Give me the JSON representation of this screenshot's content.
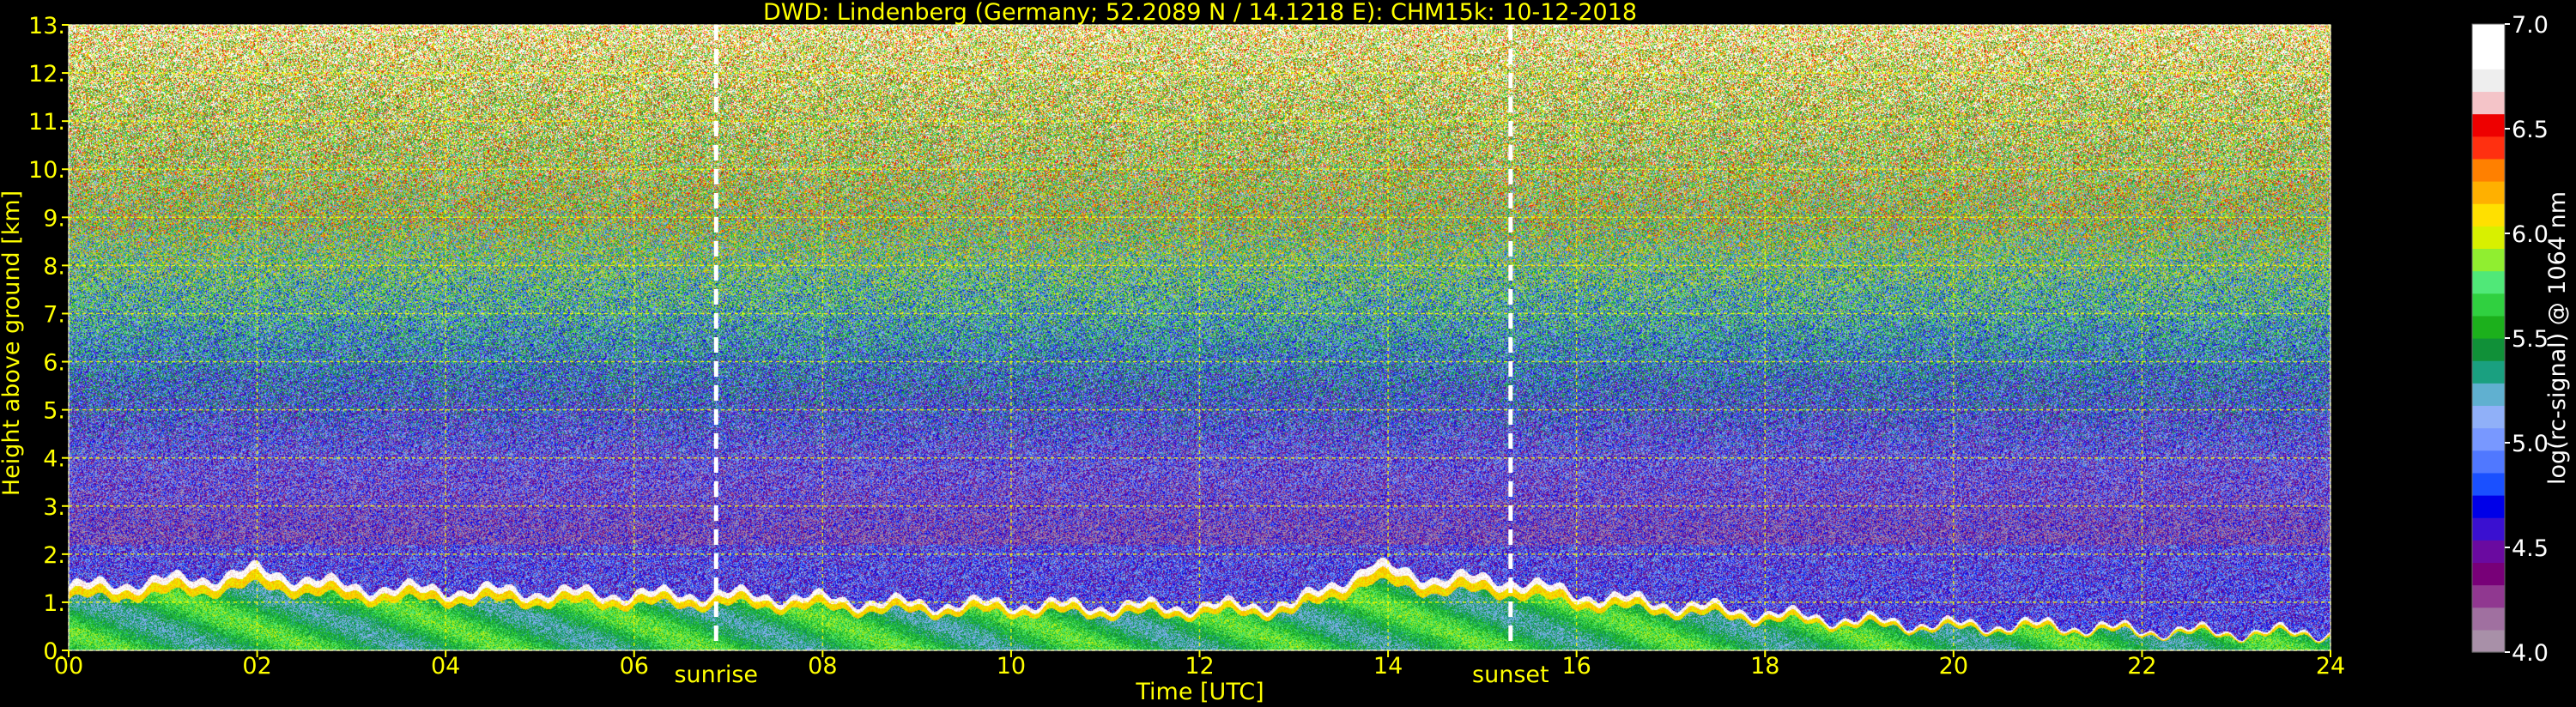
{
  "chart_data": {
    "type": "heatmap",
    "title": "DWD: Lindenberg (Germany; 52.2089 N / 14.1218 E):    CHM15k: 10-12-2018",
    "xlabel": "Time [UTC]",
    "ylabel": "Height above ground [km]",
    "xlim": [
      0,
      24
    ],
    "ylim": [
      0,
      13
    ],
    "x_ticks": [
      0,
      2,
      4,
      6,
      8,
      10,
      12,
      14,
      16,
      18,
      20,
      22,
      24
    ],
    "x_tick_labels": [
      "00",
      "02",
      "04",
      "06",
      "08",
      "10",
      "12",
      "14",
      "16",
      "18",
      "20",
      "22",
      "24"
    ],
    "y_ticks": [
      0,
      1,
      2,
      3,
      4,
      5,
      6,
      7,
      8,
      9,
      10,
      11,
      12,
      13
    ],
    "y_tick_labels": [
      "0.",
      "1.",
      "2.",
      "3.",
      "4.",
      "5.",
      "6.",
      "7.",
      "8.",
      "9.",
      "10.",
      "11.",
      "12.",
      "13."
    ],
    "grid": true,
    "grid_color": "#ffff00",
    "text_color": "#ffff00",
    "background": "#000000",
    "annotations": [
      {
        "label": "sunrise",
        "x": 6.87
      },
      {
        "label": "sunset",
        "x": 15.3
      }
    ],
    "boundary_layer_top_km": [
      [
        0,
        1.35
      ],
      [
        1.5,
        1.55
      ],
      [
        2.0,
        1.7
      ],
      [
        3.0,
        1.35
      ],
      [
        4.0,
        1.3
      ],
      [
        5.0,
        1.25
      ],
      [
        6.0,
        1.2
      ],
      [
        7.0,
        1.2
      ],
      [
        8.0,
        1.1
      ],
      [
        9.0,
        1.0
      ],
      [
        10.0,
        1.0
      ],
      [
        11.0,
        0.95
      ],
      [
        12.0,
        0.95
      ],
      [
        13.0,
        1.0
      ],
      [
        13.8,
        1.8
      ],
      [
        14.5,
        1.55
      ],
      [
        15.3,
        1.5
      ],
      [
        16.0,
        1.2
      ],
      [
        17.0,
        1.0
      ],
      [
        18.0,
        0.8
      ],
      [
        19.0,
        0.65
      ],
      [
        20.0,
        0.55
      ],
      [
        21.0,
        0.55
      ],
      [
        22.0,
        0.45
      ],
      [
        23.0,
        0.4
      ],
      [
        24.0,
        0.4
      ]
    ],
    "colorbar": {
      "label": "log(rc-signal) @ 1064 nm",
      "min": 4.0,
      "max": 7.0,
      "tick_values": [
        4.0,
        4.5,
        5.0,
        5.5,
        6.0,
        6.5,
        7.0
      ],
      "tick_labels": [
        "4.0",
        "4.5",
        "5.0",
        "5.5",
        "6.0",
        "6.5",
        "7.0"
      ],
      "colors": [
        "#a890a8",
        "#a070a0",
        "#903890",
        "#780078",
        "#6a0aa0",
        "#3a10d0",
        "#0000e8",
        "#1a50ff",
        "#5078ff",
        "#7898ff",
        "#90b0f8",
        "#60b0d0",
        "#1aa080",
        "#109038",
        "#1cb01c",
        "#30d040",
        "#50e878",
        "#90ee30",
        "#d8f000",
        "#ffe000",
        "#ffb000",
        "#ff8000",
        "#ff3010",
        "#ee0000",
        "#f4c4c8",
        "#eeeeee",
        "#ffffff",
        "#ffffff"
      ]
    }
  }
}
